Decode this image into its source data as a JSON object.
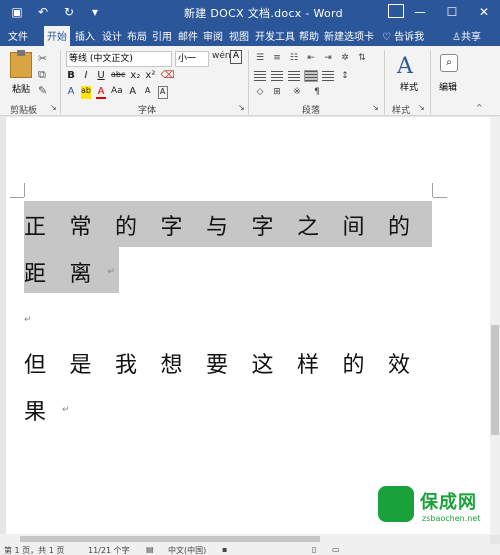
{
  "titlebar": {
    "title": "新建 DOCX 文档.docx  -  Word",
    "qat_save_icon": "save-icon",
    "qat_undo_icon": "undo-icon",
    "qat_redo_icon": "redo-icon",
    "qat_customize": "▾"
  },
  "tabs": [
    {
      "label": "文件"
    },
    {
      "label": "开始"
    },
    {
      "label": "插入"
    },
    {
      "label": "设计"
    },
    {
      "label": "布局"
    },
    {
      "label": "引用"
    },
    {
      "label": "邮件"
    },
    {
      "label": "审阅"
    },
    {
      "label": "视图"
    },
    {
      "label": "开发工具"
    },
    {
      "label": "帮助"
    },
    {
      "label": "新建选项卡"
    }
  ],
  "tellme": "告诉我",
  "share": "共享",
  "ribbon": {
    "clipboard": {
      "paste_label": "粘贴",
      "group_label": "剪贴板"
    },
    "font": {
      "font_name": "等线 (中文正文)",
      "font_size": "小一",
      "group_label": "字体",
      "row2": [
        "B",
        "I",
        "U",
        "abc",
        "x₂",
        "x²"
      ],
      "row3": [
        "A",
        "ab",
        "A",
        "Aa",
        "A",
        "A",
        "A"
      ]
    },
    "paragraph": {
      "group_label": "段落"
    },
    "styles": {
      "label": "样式",
      "group_label": "样式"
    },
    "editing": {
      "label": "编辑"
    }
  },
  "document": {
    "line1": [
      "正",
      "常",
      "的",
      "字",
      "与",
      "字",
      "之",
      "间",
      "的"
    ],
    "line2": [
      "距",
      "离"
    ],
    "line3": [
      "但",
      "是",
      "我",
      "想",
      "要",
      "这",
      "样",
      "的",
      "效"
    ],
    "line4": [
      "果"
    ],
    "para_mark": "↵"
  },
  "statusbar": {
    "page": "第 1 页，共 1 页",
    "words": "11/21 个字",
    "lang": "中文(中国)"
  },
  "watermark": {
    "text": "保成网",
    "url": "zsbaochen.net"
  },
  "colors": {
    "word_blue": "#2b579a",
    "highlight": "#c6c6c6",
    "watermark_green": "#1aa23a"
  }
}
